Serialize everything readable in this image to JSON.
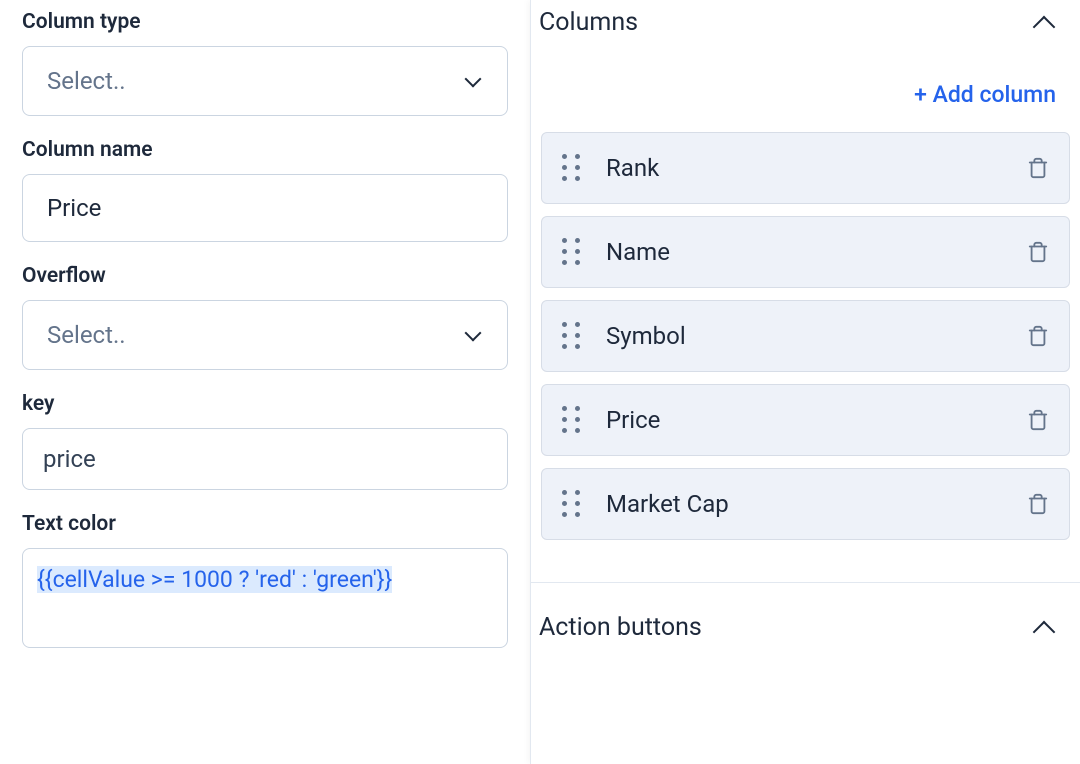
{
  "left": {
    "columnType": {
      "label": "Column type",
      "placeholder": "Select.."
    },
    "columnName": {
      "label": "Column name",
      "value": "Price"
    },
    "overflow": {
      "label": "Overflow",
      "placeholder": "Select.."
    },
    "key": {
      "label": "key",
      "value": "price"
    },
    "textColor": {
      "label": "Text color",
      "value": "{{cellValue >= 1000 ? 'red' : 'green'}}"
    }
  },
  "right": {
    "columnsSection": {
      "title": "Columns",
      "addLabel": "+ Add column"
    },
    "columns": [
      {
        "name": "Rank"
      },
      {
        "name": "Name"
      },
      {
        "name": "Symbol"
      },
      {
        "name": "Price"
      },
      {
        "name": "Market Cap"
      }
    ],
    "actionButtonsSection": {
      "title": "Action buttons"
    }
  }
}
